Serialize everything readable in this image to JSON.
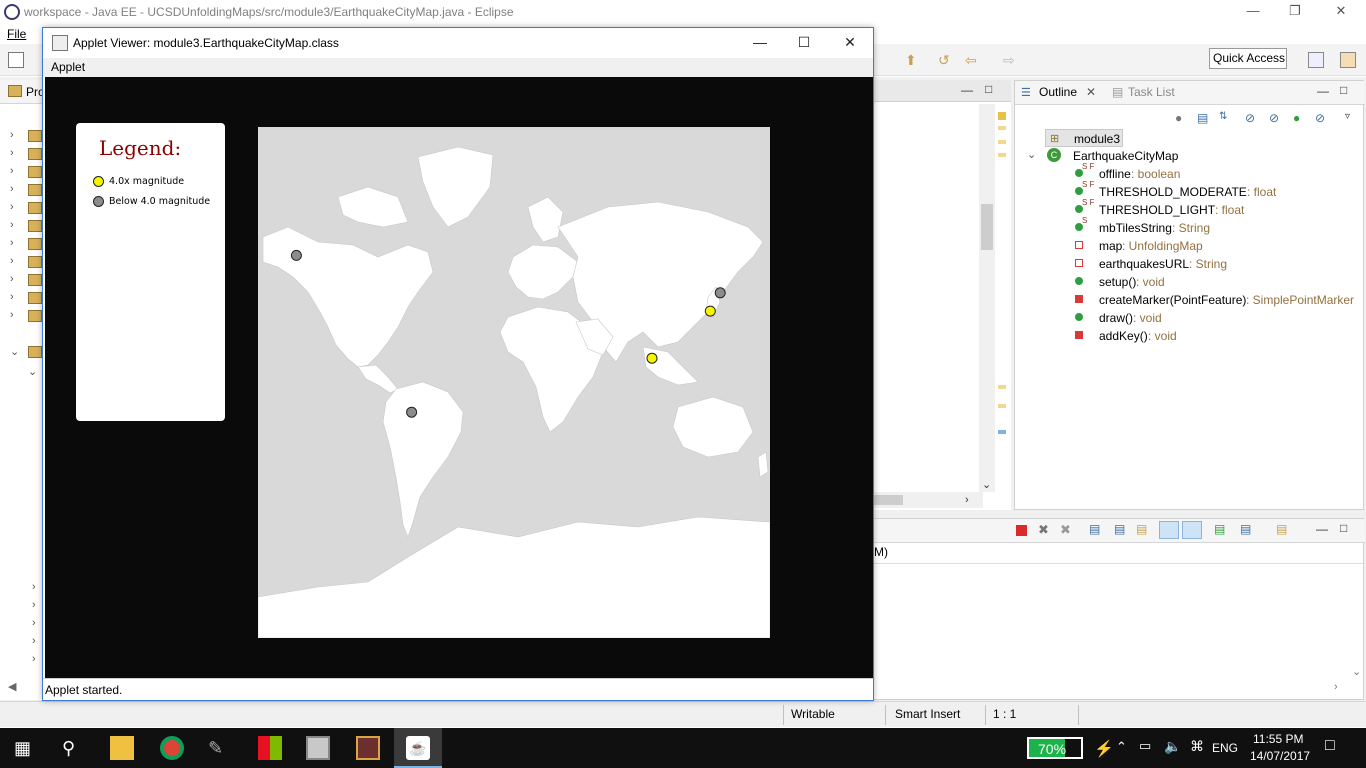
{
  "eclipse": {
    "title": "workspace - Java EE - UCSDUnfoldingMaps/src/module3/EarthquakeCityMap.java - Eclipse",
    "menu": [
      "File"
    ],
    "quick_access": "Quick Access",
    "left_panel_tab": "Pro"
  },
  "outline": {
    "tab_outline": "Outline",
    "tab_tasks": "Task List",
    "package": "module3",
    "class": "EarthquakeCityMap",
    "members": [
      {
        "name": "offline",
        "type": " : boolean",
        "sup": "S F"
      },
      {
        "name": "THRESHOLD_MODERATE",
        "type": " : float",
        "sup": "S F"
      },
      {
        "name": "THRESHOLD_LIGHT",
        "type": " : float",
        "sup": "S F"
      },
      {
        "name": "mbTilesString",
        "type": " : String",
        "sup": "S"
      },
      {
        "name": "map",
        "type": " : UnfoldingMap",
        "sup": ""
      },
      {
        "name": "earthquakesURL",
        "type": " : String",
        "sup": ""
      },
      {
        "name": "setup()",
        "type": " : void",
        "sup": ""
      },
      {
        "name": "createMarker(PointFeature)",
        "type": " : SimplePointMarker",
        "sup": ""
      },
      {
        "name": "draw()",
        "type": " : void",
        "sup": ""
      },
      {
        "name": "addKey()",
        "type": " : void",
        "sup": ""
      }
    ],
    "colors": {
      "public": "#2e9e3e",
      "private": "#d83a3a",
      "type_text": "#947040"
    }
  },
  "console": {
    "fragment": "M)"
  },
  "statusbar": {
    "writable": "Writable",
    "insert_mode": "Smart Insert",
    "position": "1 : 1"
  },
  "applet": {
    "title": "Applet Viewer: module3.EarthquakeCityMap.class",
    "menu": "Applet",
    "status": "Applet started.",
    "legend": {
      "title": "Legend:",
      "items": [
        {
          "label": "4.0x magnitude",
          "color": "#f5f500"
        },
        {
          "label": "Below 4.0 magnitude",
          "color": "#8c8c8c"
        }
      ]
    },
    "markers": [
      {
        "name": "marker-alaska",
        "category": "below",
        "lon": -153,
        "lat": 60
      },
      {
        "name": "marker-japan-north",
        "category": "below",
        "lon": 145,
        "lat": 44
      },
      {
        "name": "marker-japan",
        "category": "above",
        "lon": 138,
        "lat": 34
      },
      {
        "name": "marker-sumatra",
        "category": "above",
        "lon": 97,
        "lat": 3
      },
      {
        "name": "marker-chile",
        "category": "below",
        "lon": -72,
        "lat": -33
      }
    ]
  },
  "taskbar": {
    "battery": "70%",
    "battery_level": 0.7,
    "language": "ENG",
    "time": "11:55 PM",
    "date": "14/07/2017"
  }
}
